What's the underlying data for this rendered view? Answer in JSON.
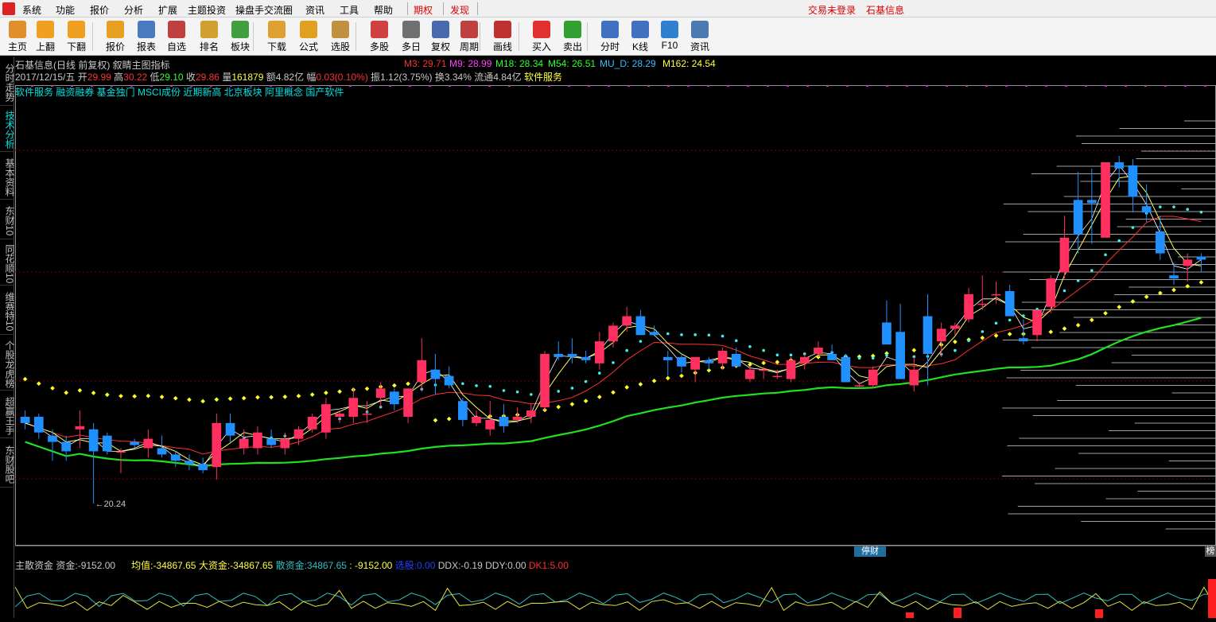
{
  "menu": {
    "items": [
      "系统",
      "功能",
      "报价",
      "分析",
      "扩展",
      "主题投资",
      "操盘手交流圈",
      "资讯",
      "工具",
      "帮助"
    ],
    "futures": "期权",
    "discover": "发现",
    "login_status": "交易未登录",
    "stock_name": "石基信息"
  },
  "toolbar": {
    "buttons": [
      {
        "label": "主页",
        "icon": "home-icon",
        "color": "#e0902a"
      },
      {
        "label": "上翻",
        "icon": "arrow-up-icon",
        "color": "#f0a020"
      },
      {
        "label": "下翻",
        "icon": "arrow-down-icon",
        "color": "#f0a020"
      },
      {
        "label": "报价",
        "icon": "price-icon",
        "color": "#e8a020"
      },
      {
        "label": "报表",
        "icon": "report-icon",
        "color": "#4a7ac0"
      },
      {
        "label": "自选",
        "icon": "f6-icon",
        "color": "#c04040"
      },
      {
        "label": "排名",
        "icon": "rank-icon",
        "color": "#d0a030"
      },
      {
        "label": "板块",
        "icon": "sector-icon",
        "color": "#40a040"
      },
      {
        "label": "下载",
        "icon": "download-icon",
        "color": "#e0a030"
      },
      {
        "label": "公式",
        "icon": "formula-icon",
        "color": "#e0a020"
      },
      {
        "label": "选股",
        "icon": "select-stock-icon",
        "color": "#c09040"
      },
      {
        "label": "多股",
        "icon": "multi-stock-icon",
        "color": "#d04040"
      },
      {
        "label": "多日",
        "icon": "multi-day-icon",
        "color": "#707070"
      },
      {
        "label": "复权",
        "icon": "adjust-icon",
        "color": "#4a6ab0"
      },
      {
        "label": "周期",
        "icon": "f8-icon",
        "color": "#c04040"
      },
      {
        "label": "画线",
        "icon": "draw-line-icon",
        "color": "#c03030"
      },
      {
        "label": "买入",
        "icon": "buy-icon",
        "color": "#e03030"
      },
      {
        "label": "卖出",
        "icon": "sell-icon",
        "color": "#30a030"
      },
      {
        "label": "分时",
        "icon": "intraday-icon",
        "color": "#4070c0"
      },
      {
        "label": "K线",
        "icon": "kline-icon",
        "color": "#4070c0"
      },
      {
        "label": "F10",
        "icon": "f10-icon",
        "color": "#3080d0"
      },
      {
        "label": "资讯",
        "icon": "news-icon",
        "color": "#4a7ab0"
      }
    ]
  },
  "left_tabs": [
    "分时走势",
    "技术分析",
    "基本资料",
    "东财10",
    "同花顺10",
    "维赛特10",
    "个股龙虎榜",
    "超赢王手",
    "东财股吧"
  ],
  "info": {
    "title": "石基信息(日线 前复权) 叙睛主图指标",
    "ma": [
      {
        "label": "M3: 29.71",
        "color": "#ff3030"
      },
      {
        "label": "M9: 28.99",
        "color": "#ff40ff"
      },
      {
        "label": "M18: 28.34",
        "color": "#30ff30"
      },
      {
        "label": "M54: 26.51",
        "color": "#30ff30"
      },
      {
        "label": "MU_D: 28.29",
        "color": "#30c0ff"
      },
      {
        "label": "M162: 24.54",
        "color": "#ffff40"
      }
    ],
    "date": "2017/12/15/五",
    "open_label": "开",
    "open": "29.99",
    "high_label": "高",
    "high": "30.22",
    "low_label": "低",
    "low": "29.10",
    "close_label": "收",
    "close": "29.86",
    "vol_label": "量",
    "vol": "161879",
    "amount": "额4.82亿",
    "change_label": "幅",
    "change": "0.03(0.10%)",
    "amplitude": "振1.12(3.75%)",
    "turnover": "换3.34%",
    "float": "流通4.84亿",
    "industry": "软件服务",
    "concepts": "软件服务 融资融券 基金独门 MSCI成份 近期新高 北京板块 阿里概念 国产软件"
  },
  "chart_data": {
    "type": "candlestick",
    "ylim": [
      19.0,
      33.2
    ],
    "low_mark": "20.24",
    "ohlc": [
      [
        23.0,
        23.2,
        22.6,
        22.8
      ],
      [
        23.0,
        23.1,
        22.3,
        22.5
      ],
      [
        22.4,
        22.6,
        21.6,
        22.2
      ],
      [
        22.2,
        22.4,
        21.6,
        21.9
      ],
      [
        22.6,
        23.2,
        22.0,
        22.7
      ],
      [
        22.6,
        22.8,
        20.24,
        21.9
      ],
      [
        22.4,
        22.5,
        21.8,
        21.9
      ],
      [
        21.9,
        22.0,
        21.2,
        21.9
      ],
      [
        22.2,
        22.3,
        22.0,
        22.1
      ],
      [
        22.0,
        22.6,
        21.7,
        22.3
      ],
      [
        22.0,
        22.4,
        21.7,
        21.8
      ],
      [
        21.8,
        21.9,
        21.4,
        21.6
      ],
      [
        21.6,
        21.8,
        21.3,
        21.5
      ],
      [
        21.5,
        21.7,
        21.2,
        21.3
      ],
      [
        21.4,
        23.1,
        21.0,
        22.8
      ],
      [
        22.8,
        23.1,
        22.2,
        22.4
      ],
      [
        22.0,
        22.6,
        21.8,
        22.3
      ],
      [
        22.0,
        22.7,
        21.8,
        22.5
      ],
      [
        22.3,
        22.6,
        22.0,
        22.1
      ],
      [
        22.0,
        22.5,
        21.8,
        22.3
      ],
      [
        22.3,
        22.7,
        22.1,
        22.6
      ],
      [
        22.6,
        23.1,
        22.5,
        23.0
      ],
      [
        22.5,
        23.6,
        22.3,
        23.4
      ],
      [
        23.0,
        23.2,
        22.8,
        23.1
      ],
      [
        23.0,
        23.9,
        22.8,
        23.6
      ],
      [
        23.1,
        23.5,
        22.8,
        23.1
      ],
      [
        23.6,
        24.1,
        23.3,
        23.9
      ],
      [
        23.8,
        23.9,
        23.2,
        23.4
      ],
      [
        23.0,
        23.9,
        22.8,
        23.9
      ],
      [
        24.1,
        25.5,
        23.8,
        24.8
      ],
      [
        24.5,
        25.0,
        23.7,
        24.2
      ],
      [
        24.3,
        24.6,
        23.9,
        24.0
      ],
      [
        23.5,
        23.6,
        22.7,
        22.9
      ],
      [
        22.8,
        23.2,
        22.7,
        23.0
      ],
      [
        22.6,
        23.5,
        22.4,
        22.9
      ],
      [
        23.0,
        23.4,
        22.5,
        22.7
      ],
      [
        22.9,
        23.3,
        22.8,
        23.0
      ],
      [
        23.0,
        23.4,
        22.8,
        23.2
      ],
      [
        23.3,
        25.1,
        23.2,
        25.0
      ],
      [
        25.0,
        25.4,
        24.8,
        24.9
      ],
      [
        25.0,
        25.5,
        24.7,
        24.9
      ],
      [
        24.9,
        25.1,
        24.7,
        24.8
      ],
      [
        24.7,
        25.7,
        24.5,
        25.4
      ],
      [
        25.4,
        26.0,
        25.2,
        25.9
      ],
      [
        25.9,
        26.5,
        25.7,
        26.2
      ],
      [
        26.2,
        26.4,
        25.6,
        25.6
      ],
      [
        25.7,
        25.9,
        25.6,
        25.6
      ],
      [
        24.9,
        25.1,
        24.3,
        24.8
      ],
      [
        24.9,
        25.0,
        24.4,
        24.6
      ],
      [
        24.5,
        24.9,
        24.1,
        24.9
      ],
      [
        24.8,
        24.9,
        24.5,
        24.7
      ],
      [
        24.7,
        25.2,
        24.5,
        25.1
      ],
      [
        25.0,
        25.2,
        24.6,
        24.6
      ],
      [
        24.2,
        24.6,
        24.1,
        24.5
      ],
      [
        24.5,
        24.6,
        24.2,
        24.5
      ],
      [
        24.3,
        24.5,
        24.2,
        24.3
      ],
      [
        24.2,
        24.9,
        24.1,
        24.8
      ],
      [
        24.7,
        25.0,
        24.5,
        24.9
      ],
      [
        25.0,
        25.4,
        24.9,
        25.2
      ],
      [
        25.0,
        25.3,
        24.8,
        24.8
      ],
      [
        24.9,
        25.0,
        24.1,
        24.1
      ],
      [
        24.0,
        24.1,
        23.9,
        24.0
      ],
      [
        24.0,
        24.6,
        23.9,
        24.5
      ],
      [
        26.0,
        26.7,
        25.3,
        25.3
      ],
      [
        25.7,
        26.6,
        24.2,
        24.2
      ],
      [
        24.0,
        24.9,
        23.8,
        24.5
      ],
      [
        26.2,
        26.9,
        24.0,
        25.0
      ],
      [
        25.4,
        26.0,
        24.9,
        25.8
      ],
      [
        25.8,
        26.0,
        25.6,
        25.9
      ],
      [
        26.1,
        27.1,
        26.0,
        26.9
      ],
      [
        26.6,
        27.5,
        26.4,
        26.6
      ],
      [
        26.9,
        27.3,
        26.6,
        26.9
      ],
      [
        27.0,
        27.2,
        26.2,
        26.2
      ],
      [
        25.5,
        26.1,
        25.3,
        25.4
      ],
      [
        25.6,
        26.4,
        25.4,
        26.4
      ],
      [
        26.5,
        27.5,
        26.3,
        27.4
      ],
      [
        27.6,
        29.4,
        27.4,
        28.7
      ],
      [
        29.9,
        30.8,
        28.2,
        28.8
      ],
      [
        29.9,
        30.9,
        28.5,
        29.8
      ],
      [
        28.7,
        31.0,
        29.0,
        31.1
      ],
      [
        31.1,
        31.3,
        30.3,
        30.9
      ],
      [
        31.0,
        31.2,
        29.5,
        30.0
      ],
      [
        29.7,
        30.4,
        29.2,
        29.5
      ],
      [
        28.9,
        29.4,
        28.0,
        28.2
      ],
      [
        27.5,
        27.9,
        27.2,
        27.4
      ],
      [
        27.8,
        28.2,
        27.3,
        28.0
      ],
      [
        28.1,
        28.2,
        27.6,
        28.0
      ]
    ]
  },
  "bottom_tags": {
    "left": "停财",
    "right": "榜"
  },
  "sub": {
    "title": "主散资金",
    "fund_label": "资金:",
    "fund": "-9152.00",
    "avg_label": "均值:",
    "avg": "-34867.65",
    "big_label": "大资金:",
    "big": "-34867.65",
    "retail_label": "散资金:",
    "retail": "34867.65",
    "retail2": ": -9152.00",
    "pick_label": "选股:",
    "pick": "0.00",
    "ddx_label": "DDX:",
    "ddx": "-0.19",
    "ddy_label": "DDY:",
    "ddy": "0.00",
    "dk_label": "DK1:",
    "dk": "5.00"
  }
}
